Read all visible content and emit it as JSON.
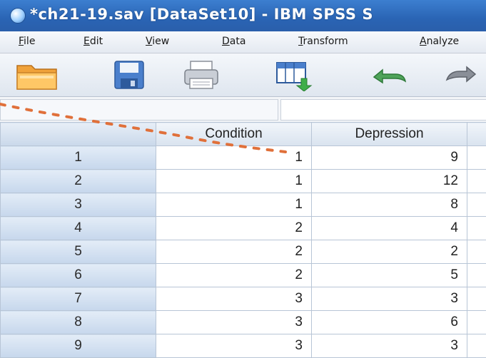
{
  "window": {
    "title": "*ch21-19.sav [DataSet10] - IBM SPSS S"
  },
  "menu": {
    "items": [
      "File",
      "Edit",
      "View",
      "Data",
      "Transform",
      "Analyze"
    ]
  },
  "toolbar": {
    "buttons": [
      "open-folder-icon",
      "save-icon",
      "print-icon",
      "data-editor-icon",
      "undo-icon",
      "redo-icon"
    ]
  },
  "grid": {
    "columns": [
      "Condition",
      "Depression"
    ],
    "rows": [
      {
        "row": "1",
        "condition": "1",
        "depression": "9"
      },
      {
        "row": "2",
        "condition": "1",
        "depression": "12"
      },
      {
        "row": "3",
        "condition": "1",
        "depression": "8"
      },
      {
        "row": "4",
        "condition": "2",
        "depression": "4"
      },
      {
        "row": "5",
        "condition": "2",
        "depression": "2"
      },
      {
        "row": "6",
        "condition": "2",
        "depression": "5"
      },
      {
        "row": "7",
        "condition": "3",
        "depression": "3"
      },
      {
        "row": "8",
        "condition": "3",
        "depression": "6"
      },
      {
        "row": "9",
        "condition": "3",
        "depression": "3"
      }
    ]
  },
  "colors": {
    "titlebar": "#2a64b4",
    "annotation": "#e0703a"
  }
}
